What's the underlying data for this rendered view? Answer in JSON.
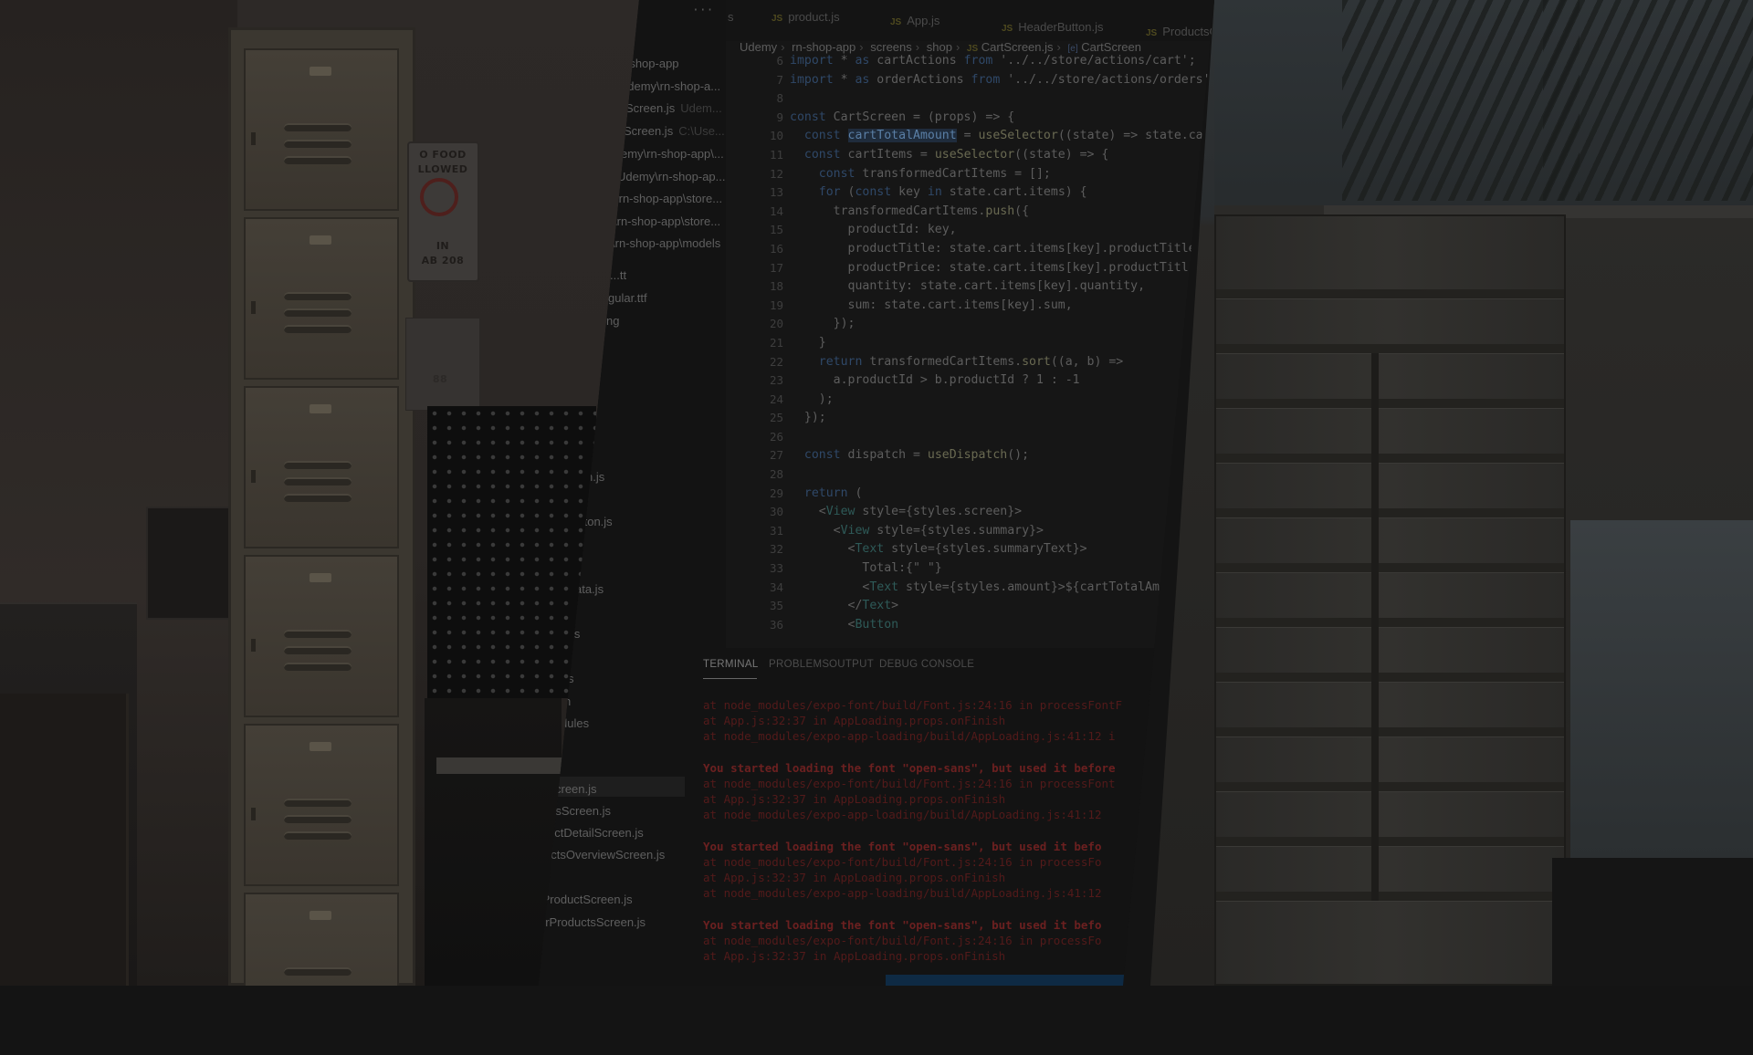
{
  "explorer": {
    "more_label": "···",
    "items": [
      {
        "label": "-shop-app",
        "hint": ""
      },
      {
        "label": "udemy\\rn-shop-a...",
        "hint": ""
      },
      {
        "label": "Screen.js",
        "hint": "Udem..."
      },
      {
        "label": "Screen.js",
        "hint": "C:\\Use..."
      },
      {
        "label": "emy\\rn-shop-app\\...",
        "hint": ""
      },
      {
        "label": "Udemy\\rn-shop-ap...",
        "hint": ""
      },
      {
        "label": "\\rn-shop-app\\store...",
        "hint": ""
      },
      {
        "label": "\\rn-shop-app\\store...",
        "hint": ""
      },
      {
        "label": "\\rn-shop-app\\models",
        "hint": ""
      },
      {
        "label": "...tt",
        "hint": ""
      },
      {
        "label": "gular.ttf",
        "hint": ""
      },
      {
        "label": "ng",
        "hint": ""
      },
      {
        "label": "n.js",
        "hint": ""
      },
      {
        "label": "tton.js",
        "hint": ""
      },
      {
        "label": "ata.js",
        "hint": ""
      },
      {
        "label": "js",
        "hint": ""
      },
      {
        "label": "s",
        "hint": ""
      },
      {
        "label": "n",
        "hint": ""
      },
      {
        "label": "dules",
        "hint": ""
      },
      {
        "label": "creen.js",
        "hint": ""
      },
      {
        "label": "rsScreen.js",
        "hint": ""
      },
      {
        "label": "uctDetailScreen.js",
        "hint": ""
      },
      {
        "label": "uctsOverviewScreen.js",
        "hint": ""
      },
      {
        "label": "tProductScreen.js",
        "hint": ""
      },
      {
        "label": "erProductsScreen.js",
        "hint": ""
      }
    ]
  },
  "tabs": [
    {
      "icon": "JS",
      "label": "s"
    },
    {
      "icon": "JS",
      "label": "product.js"
    },
    {
      "icon": "JS",
      "label": "App.js"
    },
    {
      "icon": "JS",
      "label": "HeaderButton.js"
    },
    {
      "icon": "JS",
      "label": "ProductsC"
    }
  ],
  "breadcrumb": {
    "parts": [
      "Udemy",
      "rn-shop-app",
      "screens",
      "shop"
    ],
    "file": "CartScreen.js",
    "symbol": "CartScreen",
    "js_icon": "JS",
    "symbol_icon": "[e]"
  },
  "editor": {
    "line_numbers": [
      "6",
      "7",
      "8",
      "9",
      "10",
      "11",
      "12",
      "13",
      "14",
      "15",
      "16",
      "17",
      "18",
      "19",
      "20",
      "21",
      "22",
      "23",
      "24",
      "25",
      "26",
      "27",
      "28",
      "29",
      "30",
      "31",
      "32",
      "33",
      "34",
      "35",
      "36"
    ],
    "lines": [
      "import * as cartActions from '../../store/actions/cart';",
      "import * as orderActions from '../../store/actions/orders';",
      "",
      "const CartScreen = (props) => {",
      "  const cartTotalAmount = useSelector((state) => state.ca",
      "  const cartItems = useSelector((state) => {",
      "    const transformedCartItems = [];",
      "    for (const key in state.cart.items) {",
      "      transformedCartItems.push({",
      "        productId: key,",
      "        productTitle: state.cart.items[key].productTitle",
      "        productPrice: state.cart.items[key].productTitl",
      "        quantity: state.cart.items[key].quantity,",
      "        sum: state.cart.items[key].sum,",
      "      });",
      "    }",
      "    return transformedCartItems.sort((a, b) =>",
      "      a.productId > b.productId ? 1 : -1",
      "    );",
      "  });",
      "",
      "  const dispatch = useDispatch();",
      "",
      "  return (",
      "    <View style={styles.screen}>",
      "      <View style={styles.summary}>",
      "        <Text style={styles.summaryText}>",
      "          Total:{\" \"}",
      "          <Text style={styles.amount}>${cartTotalAm",
      "        </Text>",
      "        <Button"
    ]
  },
  "panel": {
    "tabs": [
      "TERMINAL",
      "PROBLEMS",
      "OUTPUT",
      "DEBUG CONSOLE"
    ],
    "active_tab": "TERMINAL",
    "terminal_lines": [
      {
        "kind": "trace",
        "text": "at node_modules/expo-font/build/Font.js:24:16 in processFontF"
      },
      {
        "kind": "trace",
        "text": "at App.js:32:37 in AppLoading.props.onFinish"
      },
      {
        "kind": "trace",
        "text": "at node_modules/expo-app-loading/build/AppLoading.js:41:12 i"
      },
      {
        "kind": "gap",
        "text": ""
      },
      {
        "kind": "err",
        "text": "You started loading the font \"open-sans\", but used it before"
      },
      {
        "kind": "trace",
        "text": "at node_modules/expo-font/build/Font.js:24:16 in processFont"
      },
      {
        "kind": "trace",
        "text": "at App.js:32:37 in AppLoading.props.onFinish"
      },
      {
        "kind": "trace",
        "text": "at node_modules/expo-app-loading/build/AppLoading.js:41:12"
      },
      {
        "kind": "gap",
        "text": ""
      },
      {
        "kind": "err",
        "text": "You started loading the font \"open-sans\", but used it befo"
      },
      {
        "kind": "trace",
        "text": "at node_modules/expo-font/build/Font.js:24:16 in processFo"
      },
      {
        "kind": "trace",
        "text": "at App.js:32:37 in AppLoading.props.onFinish"
      },
      {
        "kind": "trace",
        "text": "at node_modules/expo-app-loading/build/AppLoading.js:41:12"
      },
      {
        "kind": "gap",
        "text": ""
      },
      {
        "kind": "err",
        "text": "You started loading the font \"open-sans\", but used it befo"
      },
      {
        "kind": "trace",
        "text": "at node_modules/expo-font/build/Font.js:24:16 in processFo"
      },
      {
        "kind": "trace",
        "text": "at App.js:32:37 in AppLoading.props.onFinish"
      }
    ]
  },
  "photo_left": {
    "sign_lines": [
      "O FOOD",
      "LLOWED",
      "IN",
      "AB 208"
    ],
    "note_text": "88"
  },
  "colors": {
    "editor_bg": "#161616",
    "error_red": "#6b2020",
    "keyword_blue": "#2f4868",
    "status_blue": "#0e2a44"
  }
}
